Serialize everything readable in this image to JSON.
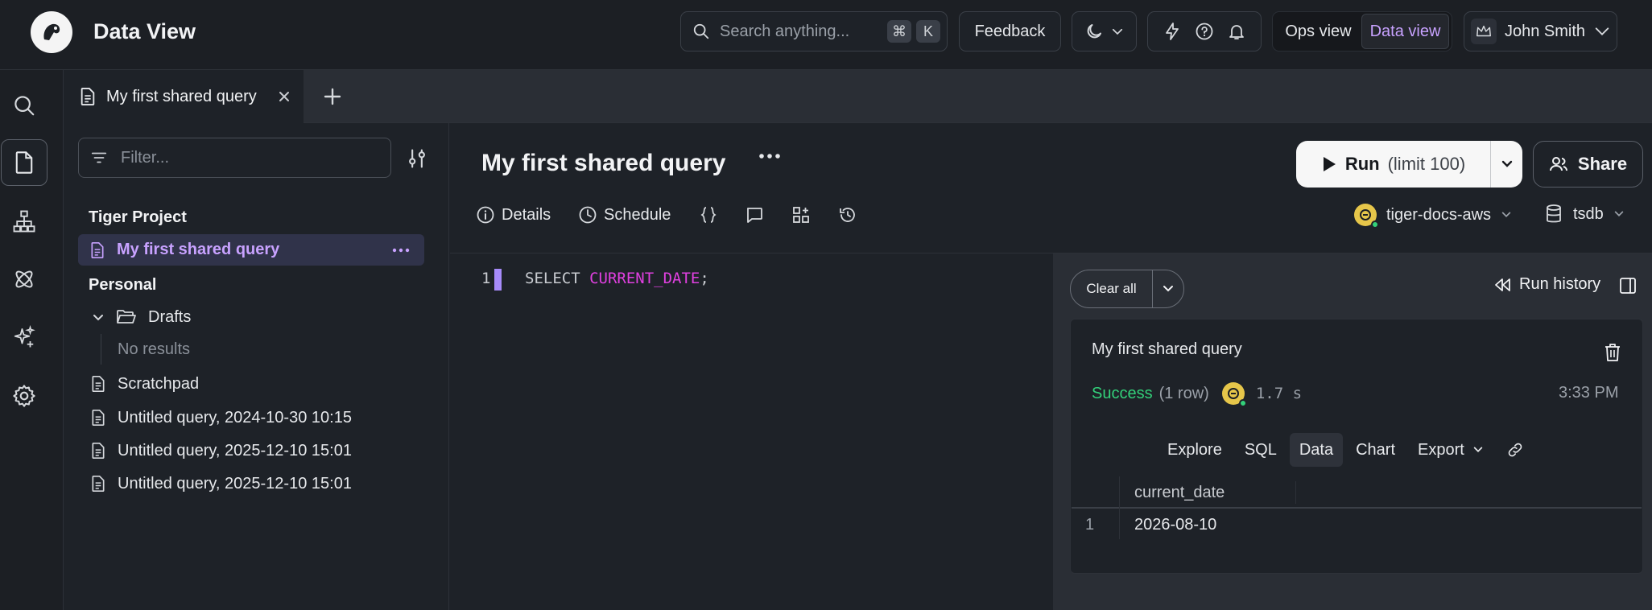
{
  "header": {
    "app_title": "Data View",
    "search_placeholder": "Search anything...",
    "shortcut_keys": [
      "⌘",
      "K"
    ],
    "feedback_label": "Feedback",
    "view_toggle": {
      "ops": "Ops view",
      "data": "Data view",
      "selected": "Data view"
    },
    "user_name": "John Smith"
  },
  "tabs": [
    {
      "label": "My first shared query",
      "active": true
    }
  ],
  "sidebar": {
    "filter_placeholder": "Filter...",
    "project_heading": "Tiger Project",
    "project_items": [
      {
        "label": "My first shared query",
        "active": true
      }
    ],
    "personal_heading": "Personal",
    "drafts_label": "Drafts",
    "drafts_empty": "No results",
    "personal_items": [
      {
        "label": "Scratchpad"
      },
      {
        "label": "Untitled query, 2024-10-30 10:15"
      },
      {
        "label": "Untitled query, 2025-12-10 15:01"
      },
      {
        "label": "Untitled query, 2025-12-10 15:01"
      }
    ]
  },
  "main": {
    "query_title": "My first shared query",
    "run_label": "Run",
    "run_limit": "(limit 100)",
    "share_label": "Share",
    "toolbar": {
      "details": "Details",
      "schedule": "Schedule"
    },
    "connection": "tiger-docs-aws",
    "database": "tsdb"
  },
  "editor": {
    "line_number": "1",
    "code_keyword": "SELECT ",
    "code_function": "CURRENT_DATE",
    "code_terminator": ";"
  },
  "results": {
    "clear_all_label": "Clear all",
    "run_history_label": "Run history",
    "card": {
      "title": "My first shared query",
      "status": "Success",
      "rows": "(1 row)",
      "duration": "1.7 s",
      "time": "3:33 PM",
      "tabs": [
        "Explore",
        "SQL",
        "Data",
        "Chart",
        "Export"
      ],
      "active_tab": "Data",
      "columns": [
        "current_date"
      ],
      "rows_data": [
        {
          "num": "1",
          "values": [
            "2026-08-10"
          ]
        }
      ]
    }
  },
  "colors": {
    "accent": "#c8a2ff",
    "success": "#33d17a",
    "sql_function": "#e040e0",
    "background": "#1e2228"
  }
}
